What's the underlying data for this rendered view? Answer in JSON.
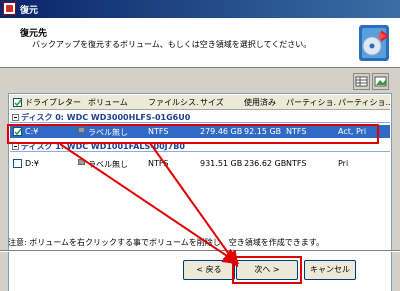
{
  "window": {
    "title": "復元"
  },
  "header": {
    "title": "復元先",
    "subtitle": "バックアップを復元するボリューム、もしくは空き領域を選択してください。"
  },
  "table": {
    "columns": [
      "ドライブレター",
      "ボリューム",
      "ファイルシス...",
      "サイズ",
      "使用済み",
      "パーティショ...",
      "パーティショ..."
    ],
    "disks": [
      {
        "label": "ディスク 0: WDC WD3000HLFS-01G6U0",
        "rows": [
          {
            "checked": true,
            "drive": "C:¥",
            "volume": "ラベル無し",
            "fs": "NTFS",
            "size": "279.46 GB",
            "used": "92.15 GB",
            "ptype": "NTFS",
            "pflags": "Act, Pri"
          }
        ]
      },
      {
        "label": "ディスク 1: WDC WD1001FALS-00J7B0",
        "rows": [
          {
            "checked": false,
            "drive": "D:¥",
            "volume": "ラベル無し",
            "fs": "NTFS",
            "size": "931.51 GB",
            "used": "236.62 GB",
            "ptype": "NTFS",
            "pflags": "Pri"
          }
        ]
      }
    ]
  },
  "note": "注意: ボリュームを右クリックする事でボリュームを削除し、空き領域を作成できます。",
  "buttons": {
    "back": "< 戻る",
    "next": "次へ >",
    "cancel": "キャンセル"
  },
  "colors": {
    "highlight": "#e00000",
    "selection": "#316ac5"
  }
}
